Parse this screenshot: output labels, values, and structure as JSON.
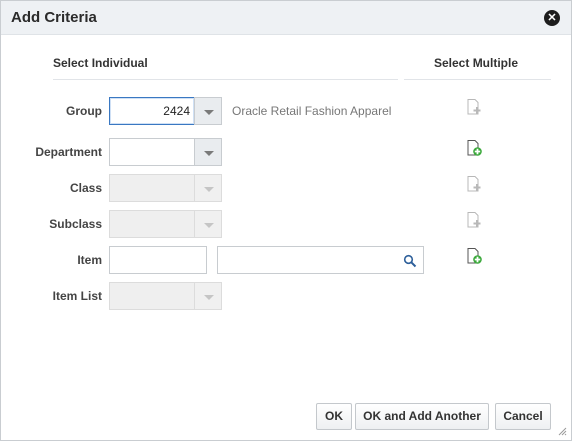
{
  "dialog": {
    "title": "Add Criteria",
    "close_icon": "close-icon"
  },
  "sections": {
    "individual": "Select Individual",
    "multiple": "Select Multiple"
  },
  "fields": {
    "group": {
      "label": "Group",
      "value": "2424",
      "description": "Oracle Retail Fashion Apparel"
    },
    "department": {
      "label": "Department",
      "value": ""
    },
    "class": {
      "label": "Class",
      "value": ""
    },
    "subclass": {
      "label": "Subclass",
      "value": ""
    },
    "item": {
      "label": "Item",
      "value": "",
      "description_value": ""
    },
    "item_list": {
      "label": "Item List",
      "value": ""
    }
  },
  "buttons": {
    "ok": "OK",
    "ok_add_another": "OK and Add Another",
    "cancel": "Cancel"
  },
  "colors": {
    "accent": "#3a78c2",
    "add_green": "#3aa83a",
    "titlebar_bg": "#eef1f4"
  }
}
